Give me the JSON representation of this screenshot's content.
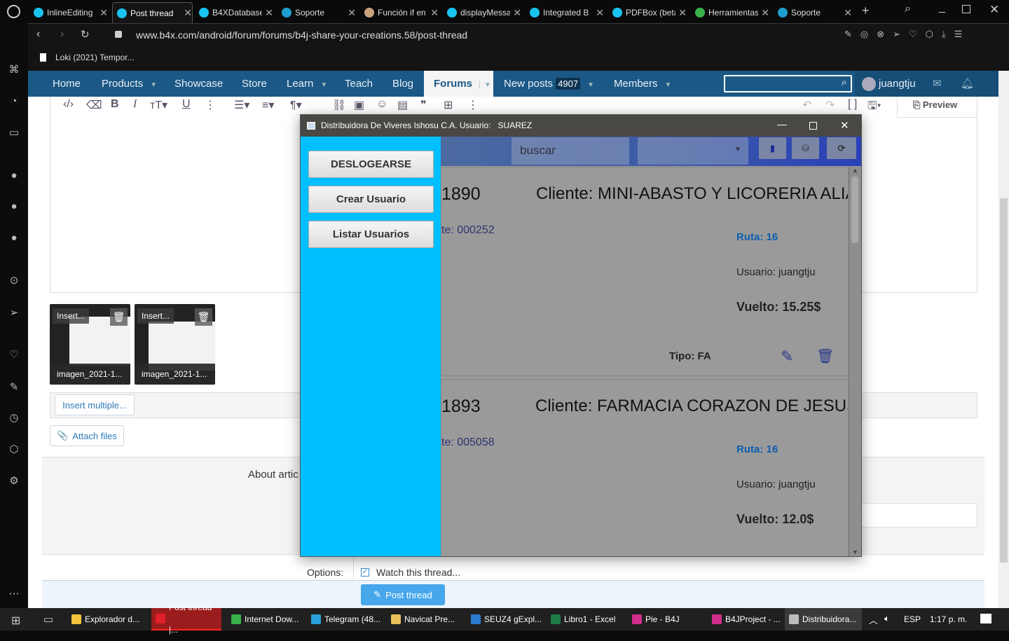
{
  "browser": {
    "tabs": [
      {
        "label": "InlineEditing",
        "color": "#19c3f0"
      },
      {
        "label": "Post thread",
        "color": "#19c3f0",
        "active": true
      },
      {
        "label": "B4XDatabase",
        "color": "#19c3f0"
      },
      {
        "label": "Soporte",
        "color": "#1e9fd0"
      },
      {
        "label": "Función if en",
        "color": "#c9a47e"
      },
      {
        "label": "displayMessage",
        "color": "#19c3f0"
      },
      {
        "label": "Integrated B",
        "color": "#19c3f0"
      },
      {
        "label": "PDFBox (beta",
        "color": "#19c3f0"
      },
      {
        "label": "Herramientas",
        "color": "#3ab04a"
      },
      {
        "label": "Soporte",
        "color": "#1e9fd0"
      }
    ],
    "url": "www.b4x.com/android/forum/forums/b4j-share-your-creations.58/post-thread",
    "bookmark": "Loki (2021) Tempor..."
  },
  "nav": {
    "items": [
      "Home",
      "Products",
      "Showcase",
      "Store",
      "Learn",
      "Teach",
      "Blog",
      "Forums",
      "New posts",
      "Members"
    ],
    "new_posts_count": "4907",
    "user": "juangtju",
    "preview": "Preview"
  },
  "editor": {
    "attachments": [
      {
        "insert": "Insert...",
        "filename": "imagen_2021-1..."
      },
      {
        "insert": "Insert...",
        "filename": "imagen_2021-1..."
      }
    ],
    "insert_multiple": "Insert multiple...",
    "attach_files": "Attach files",
    "about_label": "About artic",
    "options_label": "Options:",
    "watch_thread": "Watch this thread...",
    "post_thread": "Post thread"
  },
  "app": {
    "title": "Distribuidora De Viveres Ishosu C.A. Usuario:   SUAREZ",
    "buttons": [
      "DESLOGEARSE",
      "Crear Usuario",
      "Listar Usuarios"
    ],
    "search_placeholder": "buscar",
    "cards": [
      {
        "number": "1890",
        "cliente": "Cliente: MINI-ABASTO Y LICORERIA ALIA...",
        "code": "te: 000252",
        "ruta": "Ruta: 16",
        "usuario": "Usuario: juangtju",
        "vuelto": "Vuelto: 15.25$",
        "tipo": "Tipo: FA"
      },
      {
        "number": "1893",
        "cliente": "Cliente: FARMACIA CORAZON DE JESUS ...",
        "code": "te: 005058",
        "ruta": "Ruta: 16",
        "usuario": "Usuario: juangtju",
        "vuelto": "Vuelto: 12.0$"
      }
    ]
  },
  "taskbar": {
    "items": [
      {
        "label": "Explorador d...",
        "color": "#f3c33c"
      },
      {
        "label": "Post thread |...",
        "color": "#e0202a",
        "active": true
      },
      {
        "label": "Internet Dow...",
        "color": "#3ab04a"
      },
      {
        "label": "Telegram (48...",
        "color": "#2aa1da"
      },
      {
        "label": "Navicat Pre...",
        "color": "#e8c05a"
      },
      {
        "label": "SEUZ4 gExpl...",
        "color": "#2a7ad0"
      },
      {
        "label": "Libro1 - Excel",
        "color": "#1e7b45"
      },
      {
        "label": "Pie - B4J",
        "color": "#d22c8c"
      },
      {
        "label": "B4JProject - ...",
        "color": "#d22c8c"
      },
      {
        "label": "Distribuidora...",
        "color": "#bbbbbb"
      }
    ],
    "lang": "ESP",
    "time": "1:17 p. m."
  }
}
